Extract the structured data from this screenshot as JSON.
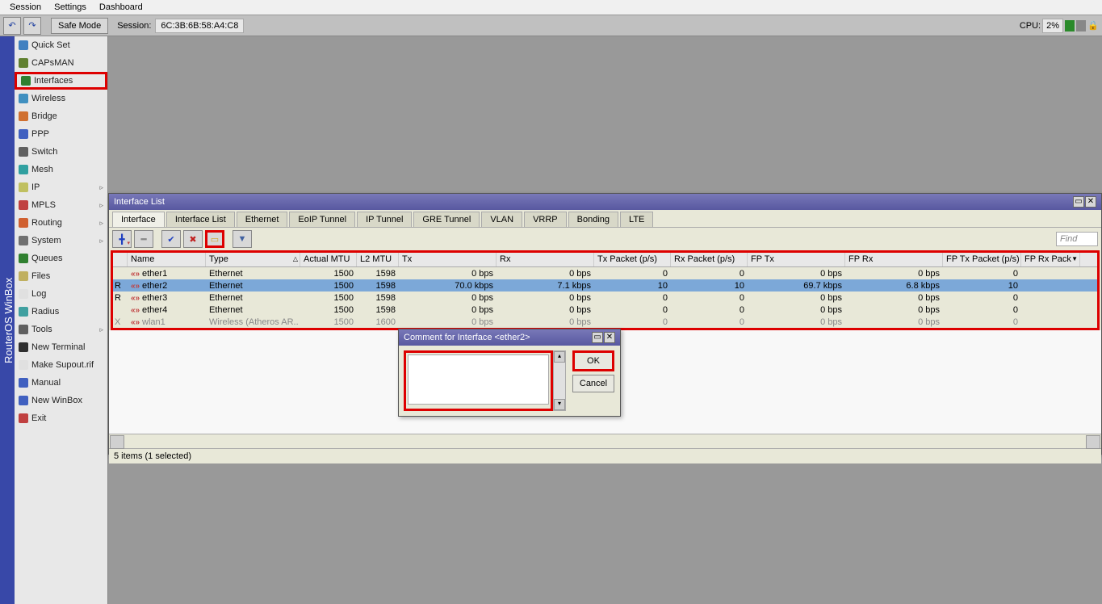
{
  "menu": {
    "session": "Session",
    "settings": "Settings",
    "dashboard": "Dashboard"
  },
  "toolbar": {
    "safemode": "Safe Mode",
    "sessionlbl": "Session:",
    "sessionval": "6C:3B:6B:58:A4:C8",
    "cpulbl": "CPU:",
    "cpuval": "2%"
  },
  "vtitle": "RouterOS WinBox",
  "sidebar": [
    {
      "label": "Quick Set",
      "color": "#4080c0"
    },
    {
      "label": "CAPsMAN",
      "color": "#608030"
    },
    {
      "label": "Interfaces",
      "color": "#308030",
      "hl": true
    },
    {
      "label": "Wireless",
      "color": "#4090c0"
    },
    {
      "label": "Bridge",
      "color": "#d07030"
    },
    {
      "label": "PPP",
      "color": "#4060c0"
    },
    {
      "label": "Switch",
      "color": "#606060"
    },
    {
      "label": "Mesh",
      "color": "#30a0a0"
    },
    {
      "label": "IP",
      "color": "#c0c060",
      "arrow": true
    },
    {
      "label": "MPLS",
      "color": "#c04040",
      "arrow": true
    },
    {
      "label": "Routing",
      "color": "#d06030",
      "arrow": true
    },
    {
      "label": "System",
      "color": "#707070",
      "arrow": true
    },
    {
      "label": "Queues",
      "color": "#308030"
    },
    {
      "label": "Files",
      "color": "#c0b060"
    },
    {
      "label": "Log",
      "color": "#e0e0e0"
    },
    {
      "label": "Radius",
      "color": "#40a0a0"
    },
    {
      "label": "Tools",
      "color": "#606060",
      "arrow": true
    },
    {
      "label": "New Terminal",
      "color": "#303030"
    },
    {
      "label": "Make Supout.rif",
      "color": "#e0e0e0"
    },
    {
      "label": "Manual",
      "color": "#4060c0"
    },
    {
      "label": "New WinBox",
      "color": "#4060c0"
    },
    {
      "label": "Exit",
      "color": "#c04040"
    }
  ],
  "iflist": {
    "title": "Interface List",
    "tabs": [
      "Interface",
      "Interface List",
      "Ethernet",
      "EoIP Tunnel",
      "IP Tunnel",
      "GRE Tunnel",
      "VLAN",
      "VRRP",
      "Bonding",
      "LTE"
    ],
    "find": "Find",
    "cols": [
      "Name",
      "Type",
      "Actual MTU",
      "L2 MTU",
      "Tx",
      "Rx",
      "Tx Packet (p/s)",
      "Rx Packet (p/s)",
      "FP Tx",
      "FP Rx",
      "FP Tx Packet (p/s)",
      "FP Rx Pack"
    ],
    "rows": [
      {
        "flag": "",
        "name": "ether1",
        "type": "Ethernet",
        "mtu": "1500",
        "l2": "1598",
        "tx": "0 bps",
        "rx": "0 bps",
        "txp": "0",
        "rxp": "0",
        "ftx": "0 bps",
        "frx": "0 bps",
        "ftxp": "0"
      },
      {
        "flag": "R",
        "name": "ether2",
        "type": "Ethernet",
        "mtu": "1500",
        "l2": "1598",
        "tx": "70.0 kbps",
        "rx": "7.1 kbps",
        "txp": "10",
        "rxp": "10",
        "ftx": "69.7 kbps",
        "frx": "6.8 kbps",
        "ftxp": "10",
        "sel": true
      },
      {
        "flag": "R",
        "name": "ether3",
        "type": "Ethernet",
        "mtu": "1500",
        "l2": "1598",
        "tx": "0 bps",
        "rx": "0 bps",
        "txp": "0",
        "rxp": "0",
        "ftx": "0 bps",
        "frx": "0 bps",
        "ftxp": "0"
      },
      {
        "flag": "",
        "name": "ether4",
        "type": "Ethernet",
        "mtu": "1500",
        "l2": "1598",
        "tx": "0 bps",
        "rx": "0 bps",
        "txp": "0",
        "rxp": "0",
        "ftx": "0 bps",
        "frx": "0 bps",
        "ftxp": "0"
      },
      {
        "flag": "X",
        "name": "wlan1",
        "type": "Wireless (Atheros AR..",
        "mtu": "1500",
        "l2": "1600",
        "tx": "0 bps",
        "rx": "0 bps",
        "txp": "0",
        "rxp": "0",
        "ftx": "0 bps",
        "frx": "0 bps",
        "ftxp": "0",
        "dis": true
      }
    ],
    "status": "5 items (1 selected)"
  },
  "dlg": {
    "title": "Comment for Interface <ether2>",
    "ok": "OK",
    "cancel": "Cancel"
  }
}
